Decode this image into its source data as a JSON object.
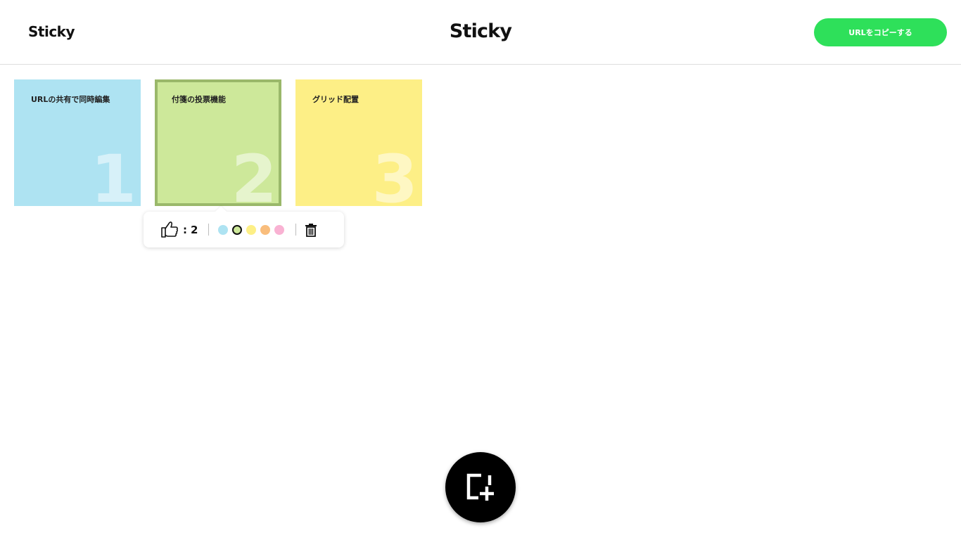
{
  "header": {
    "logo_left": "Sticky",
    "logo_center": "Sticky",
    "copy_url_button": "URLをコピーする"
  },
  "notes": [
    {
      "text": "URLの共有で同時編集",
      "number": "1",
      "color": "#aee3f2"
    },
    {
      "text": "付箋の投票機能",
      "number": "2",
      "color": "#cde89a",
      "selected": true
    },
    {
      "text": "グリッド配置",
      "number": "3",
      "color": "#fdef86"
    }
  ],
  "popover": {
    "like_icon": "thumbs-up-icon",
    "like_separator": ":",
    "like_count": "2",
    "colors": [
      "#aee3f2",
      "#cde89a",
      "#fdef86",
      "#f9bd7c",
      "#f9b2d3"
    ],
    "selected_color": "#cde89a",
    "delete_icon": "trash-icon"
  },
  "fab": {
    "icon": "add-note-icon"
  }
}
